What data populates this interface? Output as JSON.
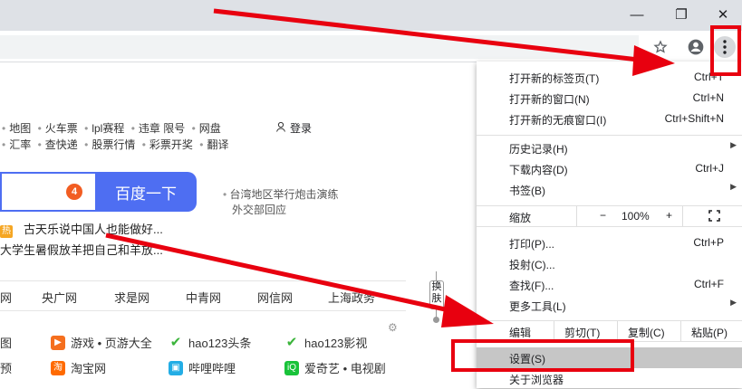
{
  "window": {
    "minimize": "—",
    "restore": "❐",
    "close": "✕"
  },
  "toolbar": {
    "star_icon": "star-icon",
    "profile_icon": "profile-icon",
    "menu_icon": "kebab-menu-icon"
  },
  "baidu": {
    "nav_row1": [
      "地图",
      "火车票",
      "lpl赛程",
      "违章 限号",
      "网盘"
    ],
    "nav_row2": [
      "汇率",
      "查快递",
      "股票行情",
      "彩票开奖",
      "翻译"
    ],
    "login": "登录",
    "badge": "4",
    "search_button": "百度一下",
    "side_news_1": "台湾地区举行炮击演练",
    "side_news_2": "外交部回应",
    "hot_1_tag": "热",
    "hot_1": "古天乐说中国人也能做好...",
    "hot_2": "大学生暑假放羊把自己和羊放...",
    "sites": [
      "网",
      "央广网",
      "求是网",
      "中青网",
      "网信网",
      "上海政务"
    ],
    "swap": "换肤",
    "links": [
      {
        "text": "图"
      },
      {
        "text": "游戏 • 页游大全"
      },
      {
        "text": "hao123头条"
      },
      {
        "text": "hao123影视"
      },
      {
        "text": "预"
      },
      {
        "text": "淘宝网"
      },
      {
        "text": "哔哩哔哩"
      },
      {
        "text": "爱奇艺 • 电视剧"
      }
    ]
  },
  "menu": {
    "items": [
      {
        "label": "打开新的标签页(T)",
        "shortcut": "Ctrl+T"
      },
      {
        "label": "打开新的窗口(N)",
        "shortcut": "Ctrl+N"
      },
      {
        "label": "打开新的无痕窗口(I)",
        "shortcut": "Ctrl+Shift+N"
      },
      {
        "label": "历史记录(H)",
        "shortcut": ""
      },
      {
        "label": "下载内容(D)",
        "shortcut": "Ctrl+J"
      },
      {
        "label": "书签(B)",
        "shortcut": ""
      },
      {
        "label": "打印(P)...",
        "shortcut": "Ctrl+P"
      },
      {
        "label": "投射(C)...",
        "shortcut": ""
      },
      {
        "label": "查找(F)...",
        "shortcut": "Ctrl+F"
      },
      {
        "label": "更多工具(L)",
        "shortcut": ""
      },
      {
        "label": "设置(S)",
        "shortcut": ""
      },
      {
        "label": "关于浏览器",
        "shortcut": ""
      }
    ],
    "zoom": {
      "label": "缩放",
      "minus": "−",
      "value": "100%",
      "plus": "+",
      "fullscreen_icon": "fullscreen-icon"
    },
    "edit": {
      "label": "编辑",
      "cut": "剪切(T)",
      "copy": "复制(C)",
      "paste": "粘贴(P)"
    }
  },
  "colors": {
    "annotation_red": "#e8000f",
    "baidu_blue": "#4e6ef2",
    "highlight": "#c6c6c6"
  }
}
